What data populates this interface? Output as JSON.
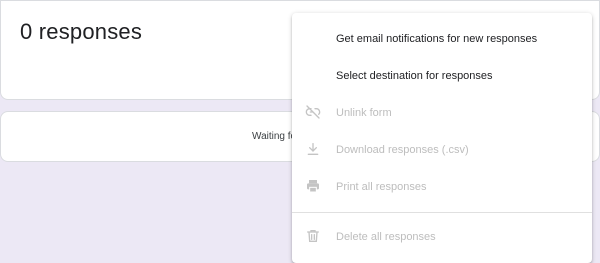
{
  "summary": {
    "responses_title": "0 responses"
  },
  "waiting": {
    "text": "Waiting for responses"
  },
  "menu": {
    "items": [
      {
        "label": "Get email notifications for new responses",
        "icon": "none",
        "enabled": true
      },
      {
        "label": "Select destination for responses",
        "icon": "none",
        "enabled": true
      },
      {
        "label": "Unlink form",
        "icon": "link-off-icon",
        "enabled": false
      },
      {
        "label": "Download responses (.csv)",
        "icon": "download-icon",
        "enabled": false
      },
      {
        "label": "Print all responses",
        "icon": "print-icon",
        "enabled": false
      },
      {
        "label": "Delete all responses",
        "icon": "trash-icon",
        "enabled": false
      }
    ]
  },
  "colors": {
    "disabled_text": "#bdbdbd",
    "enabled_text": "#202124",
    "page_background": "#ece8f5"
  }
}
